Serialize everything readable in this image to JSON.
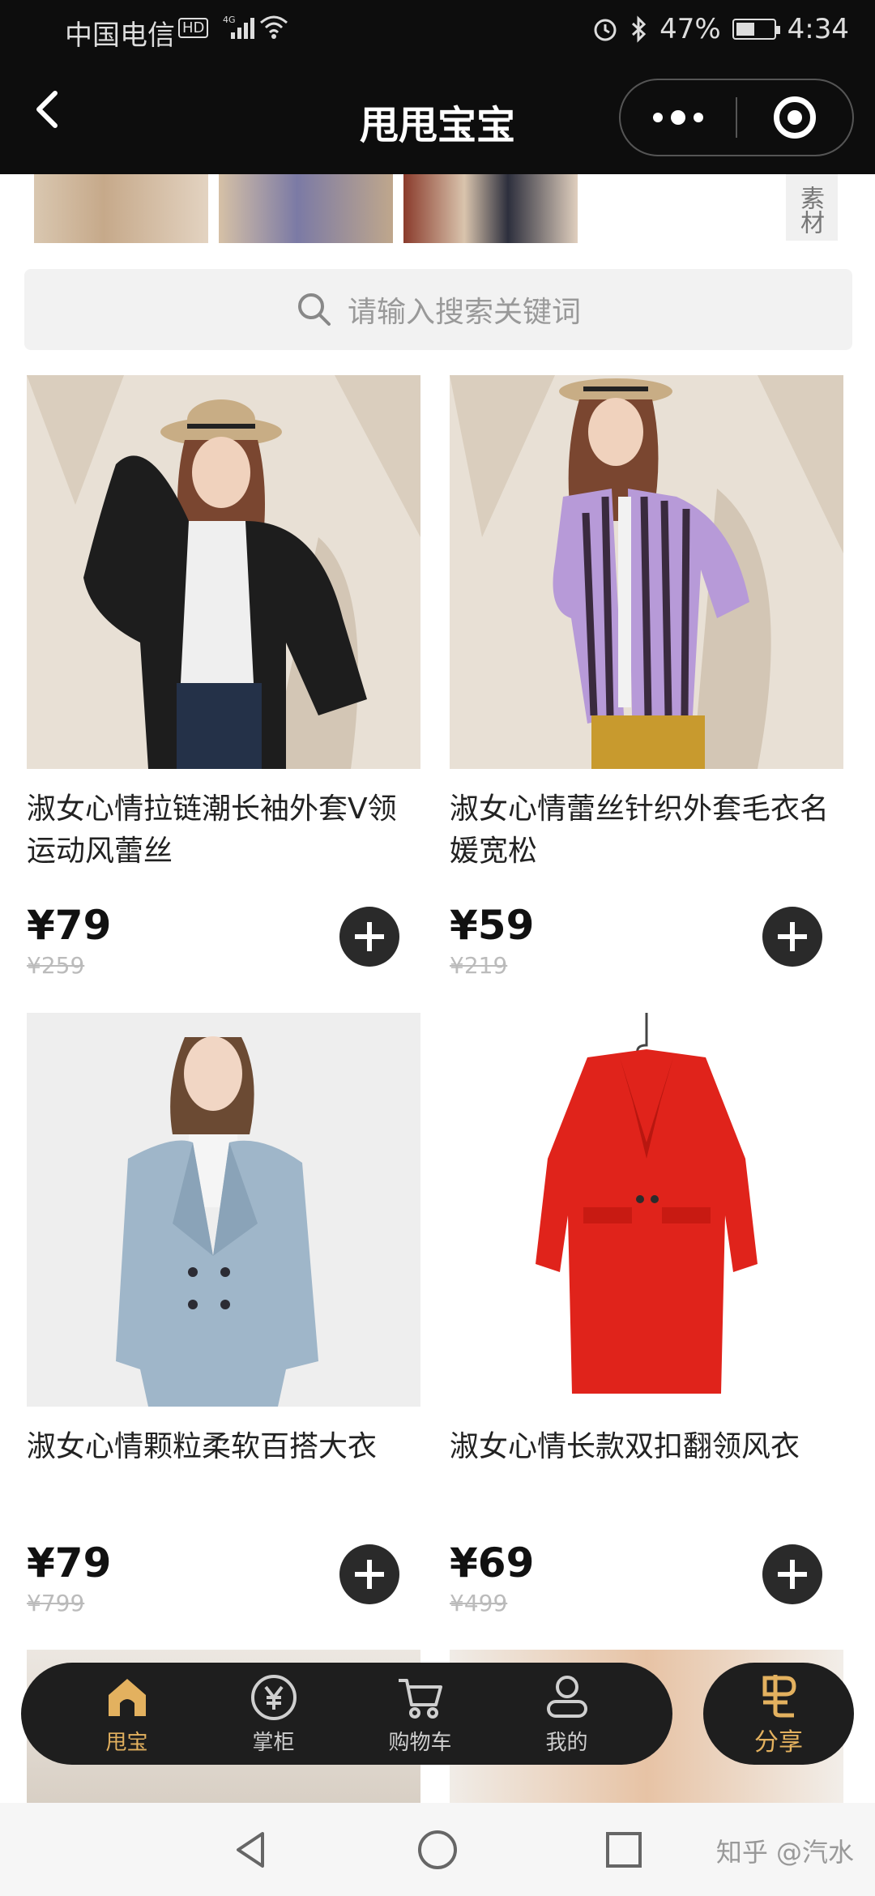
{
  "status_bar": {
    "carrier": "中国电信",
    "hd": "HD",
    "network": "4G",
    "battery": "47%",
    "time": "4:34"
  },
  "header": {
    "title": "甩甩宝宝"
  },
  "material_tab": "素材",
  "search": {
    "placeholder": "请输入搜索关键词"
  },
  "products": [
    {
      "name": "淑女心情拉链潮长袖外套V领运动风蕾丝",
      "price": "¥79",
      "original_price": "¥259"
    },
    {
      "name": "淑女心情蕾丝针织外套毛衣名媛宽松",
      "price": "¥59",
      "original_price": "¥219"
    },
    {
      "name": "淑女心情颗粒柔软百搭大衣",
      "price": "¥79",
      "original_price": "¥799"
    },
    {
      "name": "淑女心情长款双扣翻领风衣",
      "price": "¥69",
      "original_price": "¥499"
    }
  ],
  "tabbar": {
    "items": [
      {
        "label": "甩宝",
        "icon": "home-icon"
      },
      {
        "label": "掌柜",
        "icon": "yen-icon"
      },
      {
        "label": "购物车",
        "icon": "cart-icon"
      },
      {
        "label": "我的",
        "icon": "user-icon"
      }
    ],
    "share": {
      "label": "分享",
      "icon": "share-logo-icon"
    },
    "active_color": "#e3b15f"
  },
  "watermark": "知乎 @汽水"
}
